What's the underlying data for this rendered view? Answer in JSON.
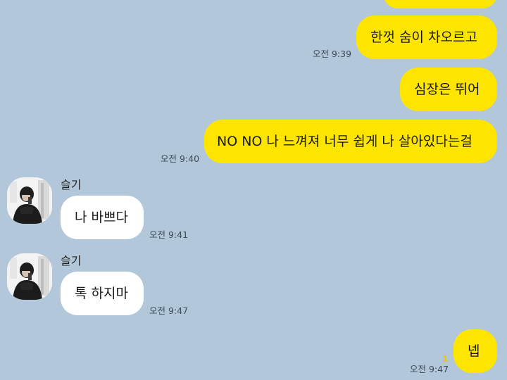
{
  "sender": {
    "name": "슬기"
  },
  "messages": [
    {
      "text": "한껏 숨이 차오르고",
      "time": "오전 9:39"
    },
    {
      "text": "심장은 뛰어"
    },
    {
      "text": "NO NO 나 느껴져 너무 쉽게 나 살아있다는걸",
      "time": "오전 9:40"
    },
    {
      "text": "나 바쁘다",
      "time": "오전 9:41"
    },
    {
      "text": "톡 하지마",
      "time": "오전 9:47"
    },
    {
      "text": "넵",
      "time": "오전 9:47",
      "unread": "1"
    }
  ],
  "icons": {
    "avatar": "profile-photo"
  },
  "colors": {
    "background": "#b2c7da",
    "my_bubble": "#fee500",
    "other_bubble": "#ffffff",
    "unread": "#e3c900"
  }
}
